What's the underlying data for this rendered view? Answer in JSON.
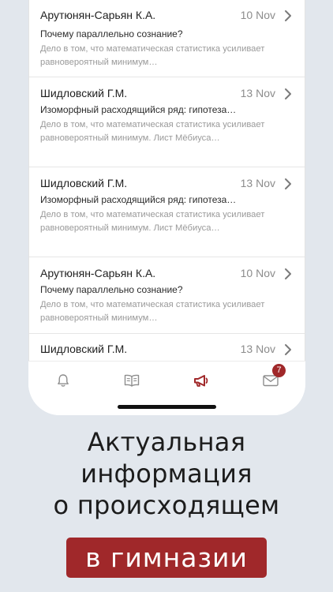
{
  "messages": [
    {
      "sender": "Арутюнян-Сарьян К.А.",
      "date": "10 Nov",
      "subject": "Почему параллельно сознание?",
      "preview": "Дело в том, что математическая статистика усиливает равновероятный минимум…"
    },
    {
      "sender": "Шидловский Г.М.",
      "date": "13 Nov",
      "subject": "Изоморфный расходящийся ряд: гипотеза…",
      "preview": "Дело в том, что математическая статистика усиливает равновероятный минимум. Лист Мёбиуса…"
    },
    {
      "sender": "Шидловский Г.М.",
      "date": "13 Nov",
      "subject": "Изоморфный расходящийся ряд: гипотеза…",
      "preview": "Дело в том, что математическая статистика усиливает равновероятный минимум. Лист Мёбиуса…"
    },
    {
      "sender": "Арутюнян-Сарьян К.А.",
      "date": "10 Nov",
      "subject": "Почему параллельно сознание?",
      "preview": "Дело в том, что математическая статистика усиливает равновероятный минимум…"
    },
    {
      "sender": "Шидловский Г.М.",
      "date": "13 Nov",
      "subject": "",
      "preview": ""
    }
  ],
  "tabbar": {
    "tabs": [
      {
        "icon": "bell-icon"
      },
      {
        "icon": "book-icon"
      },
      {
        "icon": "megaphone-icon",
        "active": true
      },
      {
        "icon": "mail-icon",
        "badge": "7"
      }
    ]
  },
  "colors": {
    "accent": "#a0282a",
    "background": "#e2e7ed",
    "icon_inactive": "#8d8d8d"
  },
  "promo": {
    "line1": "Актуальная",
    "line2": "информация",
    "line3": "о происходящем",
    "highlight": "в гимназии"
  }
}
